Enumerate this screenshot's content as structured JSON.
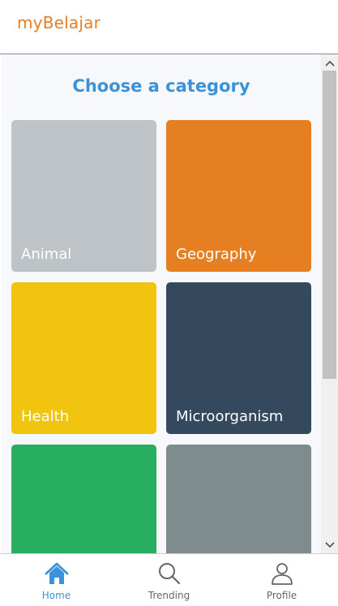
{
  "header": {
    "title": "myBelajar"
  },
  "main": {
    "heading": "Choose a category",
    "categories": [
      {
        "label": "Animal",
        "color": "#bdc3c7"
      },
      {
        "label": "Geography",
        "color": "#e67e22"
      },
      {
        "label": "Health",
        "color": "#f1c40f"
      },
      {
        "label": "Microorganism",
        "color": "#34495e"
      },
      {
        "label": "",
        "color": "#27ae60"
      },
      {
        "label": "",
        "color": "#7f8c8d"
      }
    ]
  },
  "bottom_nav": {
    "items": [
      {
        "label": "Home",
        "icon": "home-icon",
        "active": true
      },
      {
        "label": "Trending",
        "icon": "search-icon",
        "active": false
      },
      {
        "label": "Profile",
        "icon": "user-icon",
        "active": false
      }
    ]
  },
  "colors": {
    "accent": "#3a93d8",
    "brand": "#e67e22"
  }
}
